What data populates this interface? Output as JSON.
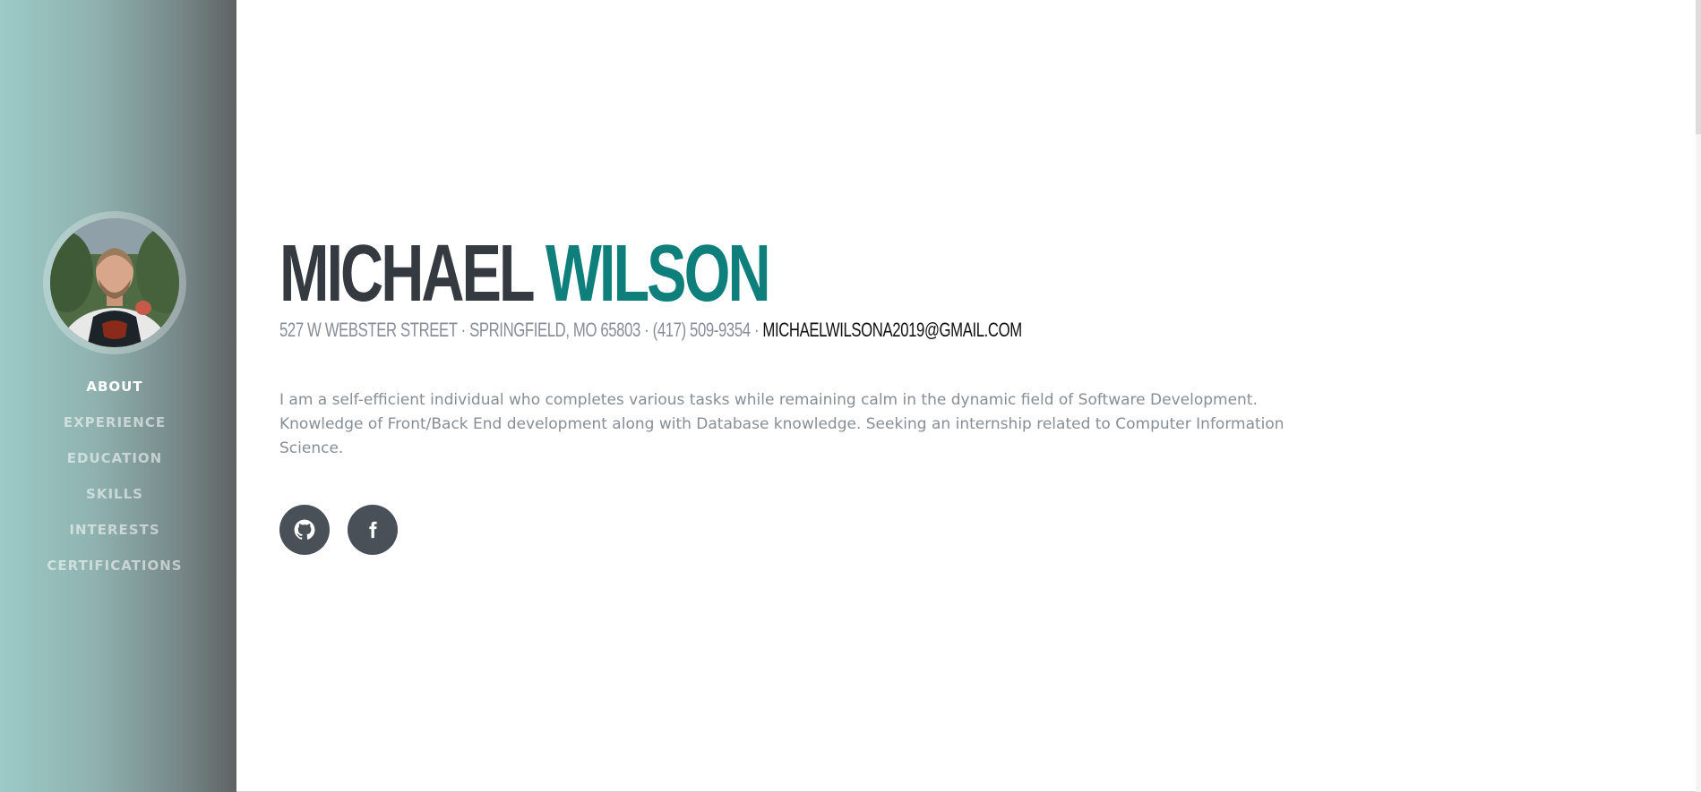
{
  "profile": {
    "first_name": "MICHAEL",
    "last_name": "WILSON",
    "address": "527 W WEBSTER STREET · SPRINGFIELD, MO 65803 · (417) 509-9354 · ",
    "email": "MICHAELWILSONA2019@GMAIL.COM",
    "about": "I am a self-efficient individual who completes various tasks while remaining calm in the dynamic field of Software Development. Knowledge of Front/Back End development along with Database knowledge. Seeking an internship related to Computer Information Science."
  },
  "nav": {
    "items": [
      {
        "label": "ABOUT",
        "active": true
      },
      {
        "label": "EXPERIENCE",
        "active": false
      },
      {
        "label": "EDUCATION",
        "active": false
      },
      {
        "label": "SKILLS",
        "active": false
      },
      {
        "label": "INTERESTS",
        "active": false
      },
      {
        "label": "CERTIFICATIONS",
        "active": false
      }
    ]
  },
  "social": {
    "icons": [
      "github-icon",
      "facebook-icon"
    ]
  },
  "colors": {
    "accent": "#0f7f7c",
    "dark": "#343a40",
    "muted": "#868e96",
    "social_button": "#495057"
  }
}
